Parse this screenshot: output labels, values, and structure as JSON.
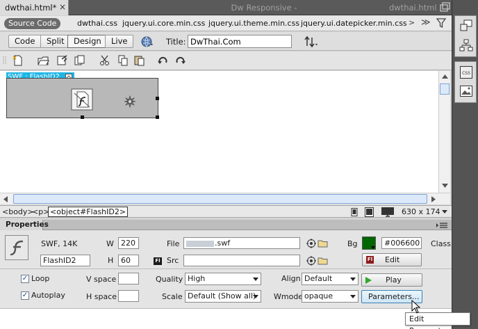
{
  "tabs": {
    "active_file": "dwthai.html*",
    "close": "×"
  },
  "window": {
    "title": "Dw Responsive -",
    "file": "dwthai.html"
  },
  "related_files": {
    "source_code": "Source Code",
    "files": [
      "dwthai.css",
      "jquery.ui.core.min.css",
      "jquery.ui.theme.min.css",
      "jquery.ui.datepicker.min.css"
    ],
    "more": ">",
    "overflow": "≫"
  },
  "doc_toolbar": {
    "views": [
      "Code",
      "Split",
      "Design",
      "Live"
    ],
    "active_view": "Design",
    "title_label": "Title:",
    "title_value": "DwThai.Com"
  },
  "design": {
    "swf_label": "SWF : FlashID2"
  },
  "status_bar": {
    "tags": [
      "<body>",
      "<p>",
      "<object#FlashID2>"
    ],
    "dimensions": "630 x 174"
  },
  "properties": {
    "panel_title": "Properties",
    "type_info": "SWF, 14K",
    "id_value": "FlashID2",
    "w_label": "W",
    "w_value": "220",
    "h_label": "H",
    "h_value": "60",
    "file_label": "File",
    "file_value": ".swf",
    "src_label": "Src",
    "src_value": "",
    "fl_badge": "Fl",
    "bg_label": "Bg",
    "bg_value": "#006600",
    "class_label": "Class",
    "edit_label": "Edit",
    "loop_label": "Loop",
    "autoplay_label": "Autoplay",
    "loop_checked": true,
    "autoplay_checked": true,
    "vspace_label": "V space",
    "hspace_label": "H space",
    "quality_label": "Quality",
    "quality_value": "High",
    "scale_label": "Scale",
    "scale_value": "Default (Show all)",
    "align_label": "Align",
    "align_value": "Default",
    "wmode_label": "Wmode",
    "wmode_value": "opaque",
    "play_label": "Play",
    "params_label": "Parameters...",
    "check": "✓"
  },
  "tooltip": "Edit Parameters",
  "colors": {
    "bg_swatch": "#006600",
    "swf_label_bg": "#1fb6e6"
  },
  "icons": [
    "close-icon",
    "filter-icon",
    "globe-icon",
    "file-management-icon",
    "cut-icon",
    "copy-icon",
    "paste-icon",
    "undo-icon",
    "redo-icon",
    "flash-icon",
    "browse-folder-icon",
    "point-to-file-icon",
    "play-icon",
    "css-icon"
  ]
}
